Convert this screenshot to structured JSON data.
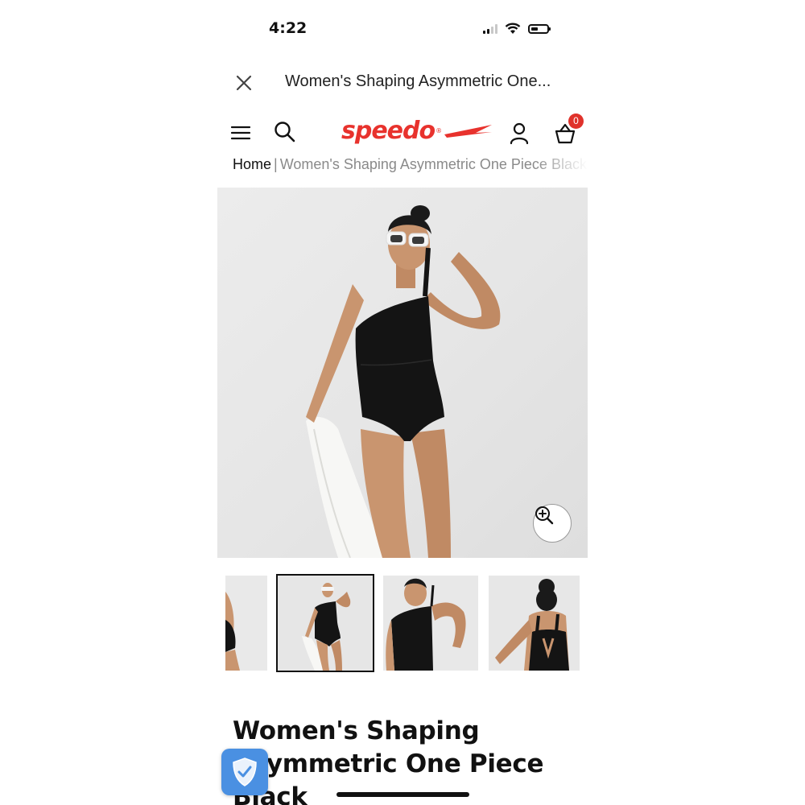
{
  "status_bar": {
    "time": "4:22",
    "icons": [
      "cellular-signal-icon",
      "wifi-icon",
      "battery-icon"
    ]
  },
  "browser_header": {
    "close_icon": "close-icon",
    "page_title": "Women's Shaping Asymmetric One..."
  },
  "site_header": {
    "menu_icon": "hamburger-menu-icon",
    "search_icon": "search-icon",
    "logo_text": "speedo",
    "account_icon": "user-account-icon",
    "cart_icon": "shopping-basket-icon",
    "cart_count": "0",
    "brand_color": "#e8322d"
  },
  "breadcrumb": {
    "home": "Home",
    "separator": "|",
    "current": "Women's Shaping Asymmetric One Piece Black"
  },
  "product_gallery": {
    "zoom_icon": "zoom-in-icon",
    "thumbnail_count": 4,
    "selected_thumbnail": 1
  },
  "product": {
    "title": "Women's Shaping Asymmetric One Piece Black"
  },
  "trust_badge": {
    "icon": "shield-check-icon",
    "color": "#4a90e2"
  }
}
